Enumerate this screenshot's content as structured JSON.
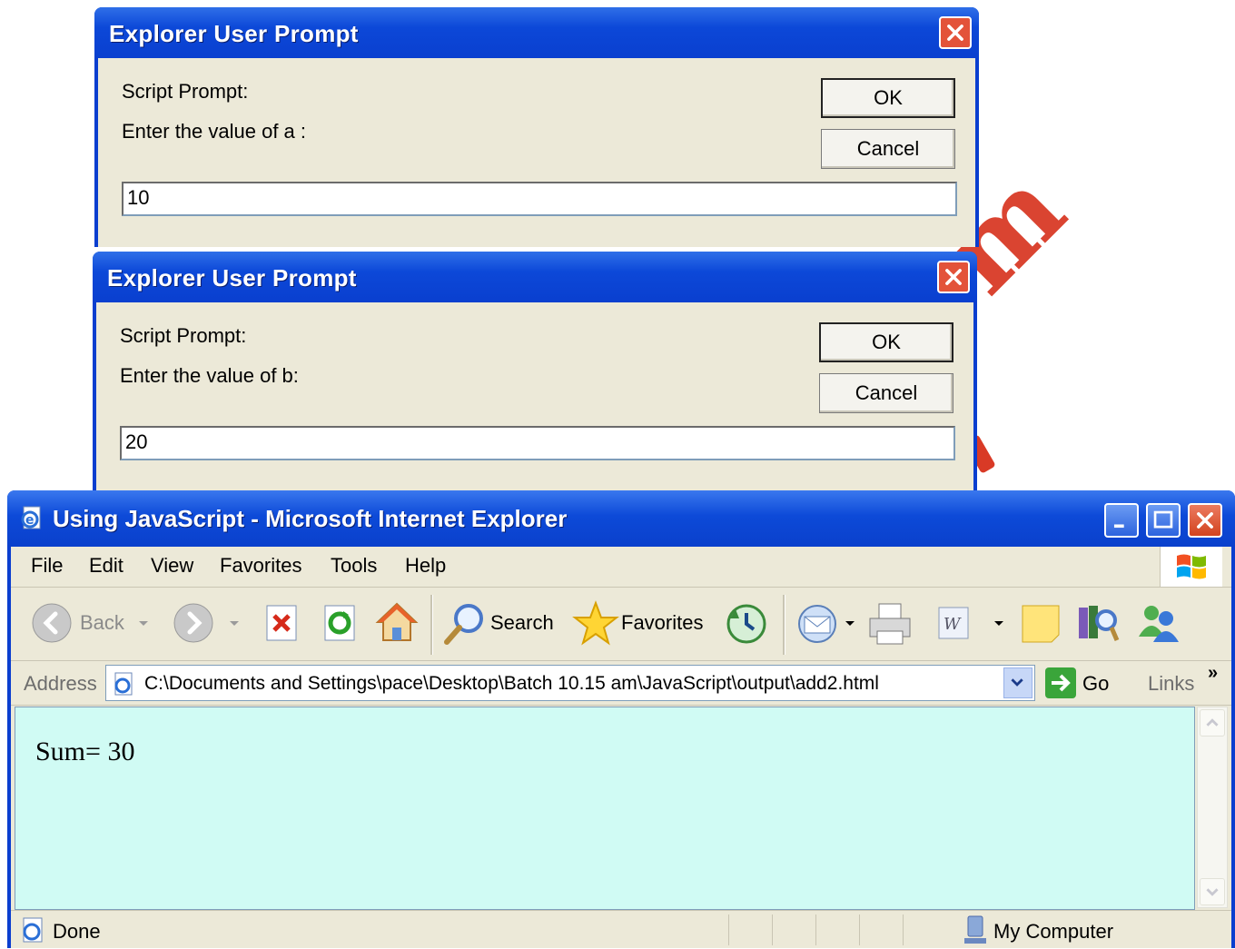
{
  "dialog1": {
    "title": "Explorer User Prompt",
    "label1": "Script Prompt:",
    "label2": "Enter the value of a :",
    "ok": "OK",
    "cancel": "Cancel",
    "input_value": "10"
  },
  "dialog2": {
    "title": "Explorer User Prompt",
    "label1": "Script Prompt:",
    "label2": "Enter the value of b:",
    "ok": "OK",
    "cancel": "Cancel",
    "input_value": "20"
  },
  "browser": {
    "title": "Using JavaScript - Microsoft Internet Explorer",
    "menu": [
      "File",
      "Edit",
      "View",
      "Favorites",
      "Tools",
      "Help"
    ],
    "toolbar": {
      "back": "Back",
      "search": "Search",
      "favorites": "Favorites"
    },
    "address_label": "Address",
    "address_value": "C:\\Documents and Settings\\pace\\Desktop\\Batch 10.15 am\\JavaScript\\output\\add2.html",
    "go": "Go",
    "links": "Links",
    "links_chevron": "»",
    "content_text": "Sum= 30",
    "status_text": "Done",
    "zone_text": "My Computer"
  },
  "colors": {
    "titlebar": "#0a3ecf",
    "dialog_face": "#ece9d8",
    "page_background": "#d0fbf4",
    "close_red": "#e3533a"
  }
}
